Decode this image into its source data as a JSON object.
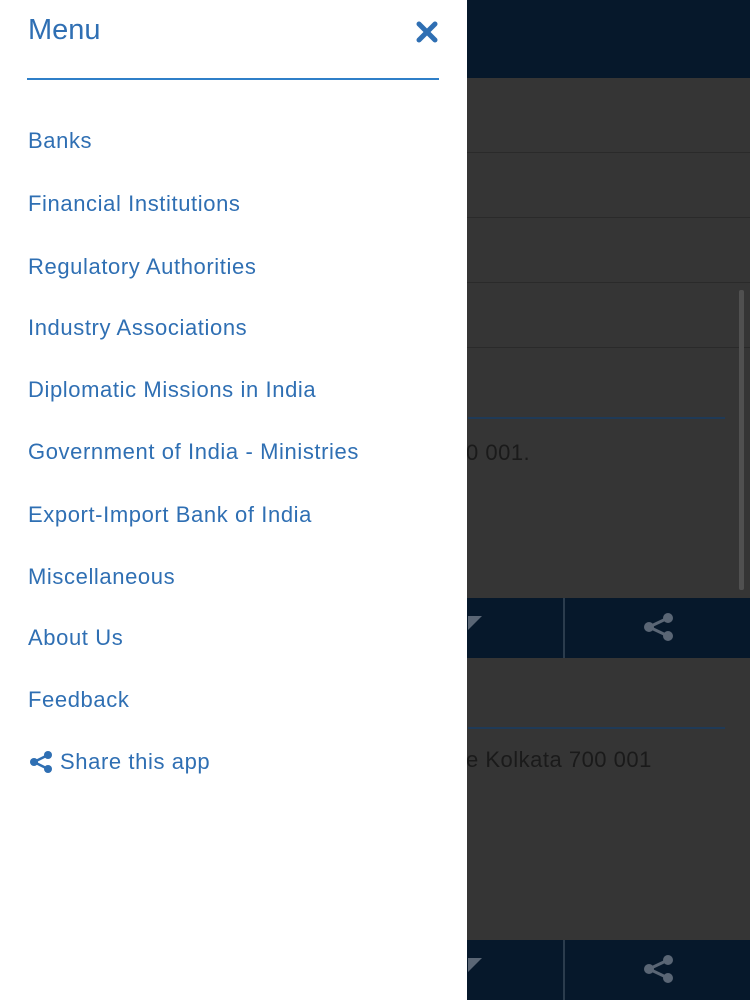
{
  "menu": {
    "title": "Menu",
    "close_icon": "close-icon",
    "items": [
      {
        "label": "Banks"
      },
      {
        "label": "Financial Institutions"
      },
      {
        "label": "Regulatory Authorities"
      },
      {
        "label": "Industry Associations"
      },
      {
        "label": "Diplomatic Missions in India"
      },
      {
        "label": "Government of India - Ministries"
      },
      {
        "label": "Export-Import Bank of India"
      },
      {
        "label": "Miscellaneous"
      },
      {
        "label": "About Us"
      },
      {
        "label": "Feedback"
      }
    ],
    "share": {
      "label": "Share this app",
      "icon": "share-icon"
    }
  },
  "background": {
    "card1_address_fragment": "0 001.",
    "card2_address_fragment": "e Kolkata 700 001",
    "action_icons": [
      "mail-icon",
      "share-icon"
    ]
  },
  "colors": {
    "accent": "#2f6fb3",
    "header_navy": "#06182b",
    "overlay": "#353535"
  }
}
